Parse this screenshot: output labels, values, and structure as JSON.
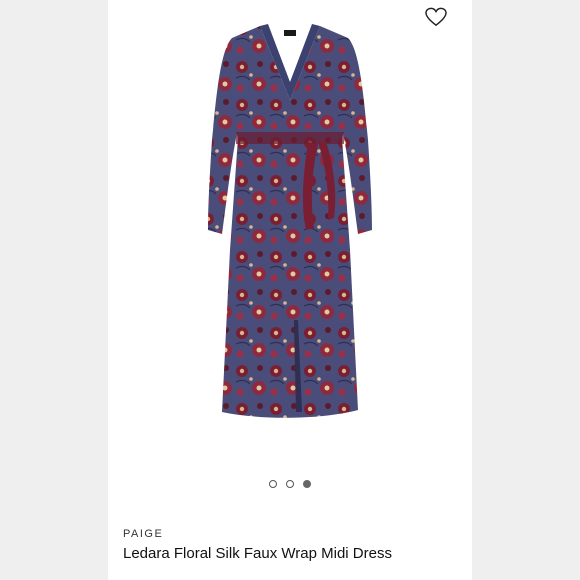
{
  "product": {
    "brand": "PAIGE",
    "title": "Ledara Floral Silk Faux Wrap Midi Dress"
  },
  "gallery": {
    "dots": [
      {
        "active": false
      },
      {
        "active": false
      },
      {
        "active": true
      }
    ]
  },
  "colors": {
    "dress_base": "#4a4c7a",
    "dress_floral": "#7a1f33",
    "accent": "#d9b58a",
    "background": "#efefef"
  },
  "icons": {
    "favorite": "heart-outline-icon"
  }
}
